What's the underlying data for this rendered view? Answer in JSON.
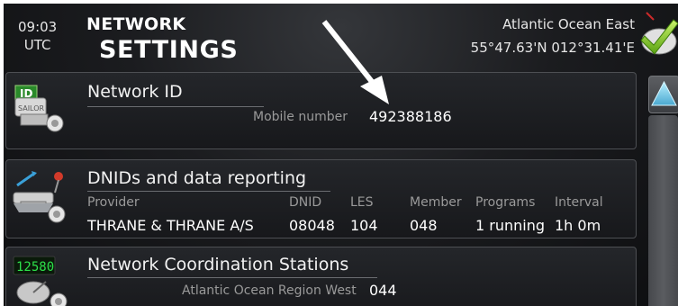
{
  "header": {
    "time": "09:03",
    "timezone": "UTC",
    "title_line1": "NETWORK",
    "title_line2": "SETTINGS",
    "region": "Atlantic Ocean East",
    "position": "55°47.63'N 012°31.41'E",
    "status_icon": "check-icon"
  },
  "network_id": {
    "title": "Network ID",
    "icon": "sailor-id-icon",
    "icon_text_top": "ID",
    "icon_text_brand": "SAILOR",
    "mobile_label": "Mobile number",
    "mobile_value": "492388186"
  },
  "dnid": {
    "title": "DNIDs and data reporting",
    "icon": "data-reporting-icon",
    "headers": {
      "provider": "Provider",
      "dnid": "DNID",
      "les": "LES",
      "member": "Member",
      "programs": "Programs",
      "interval": "Interval"
    },
    "row": {
      "provider": "THRANE & THRANE A/S",
      "dnid": "08048",
      "les": "104",
      "member": "048",
      "programs": "1 running",
      "interval": "1h 0m"
    }
  },
  "ncs": {
    "title": "Network Coordination Stations",
    "icon": "satellite-dish-icon",
    "icon_display": "12580",
    "region_label": "Atlantic Ocean Region West",
    "region_value": "044"
  },
  "colors": {
    "background": "#1b1c1f",
    "panel_border": "#4d4f53",
    "accent_green": "#8fd12a",
    "display_green": "#2de04a"
  }
}
